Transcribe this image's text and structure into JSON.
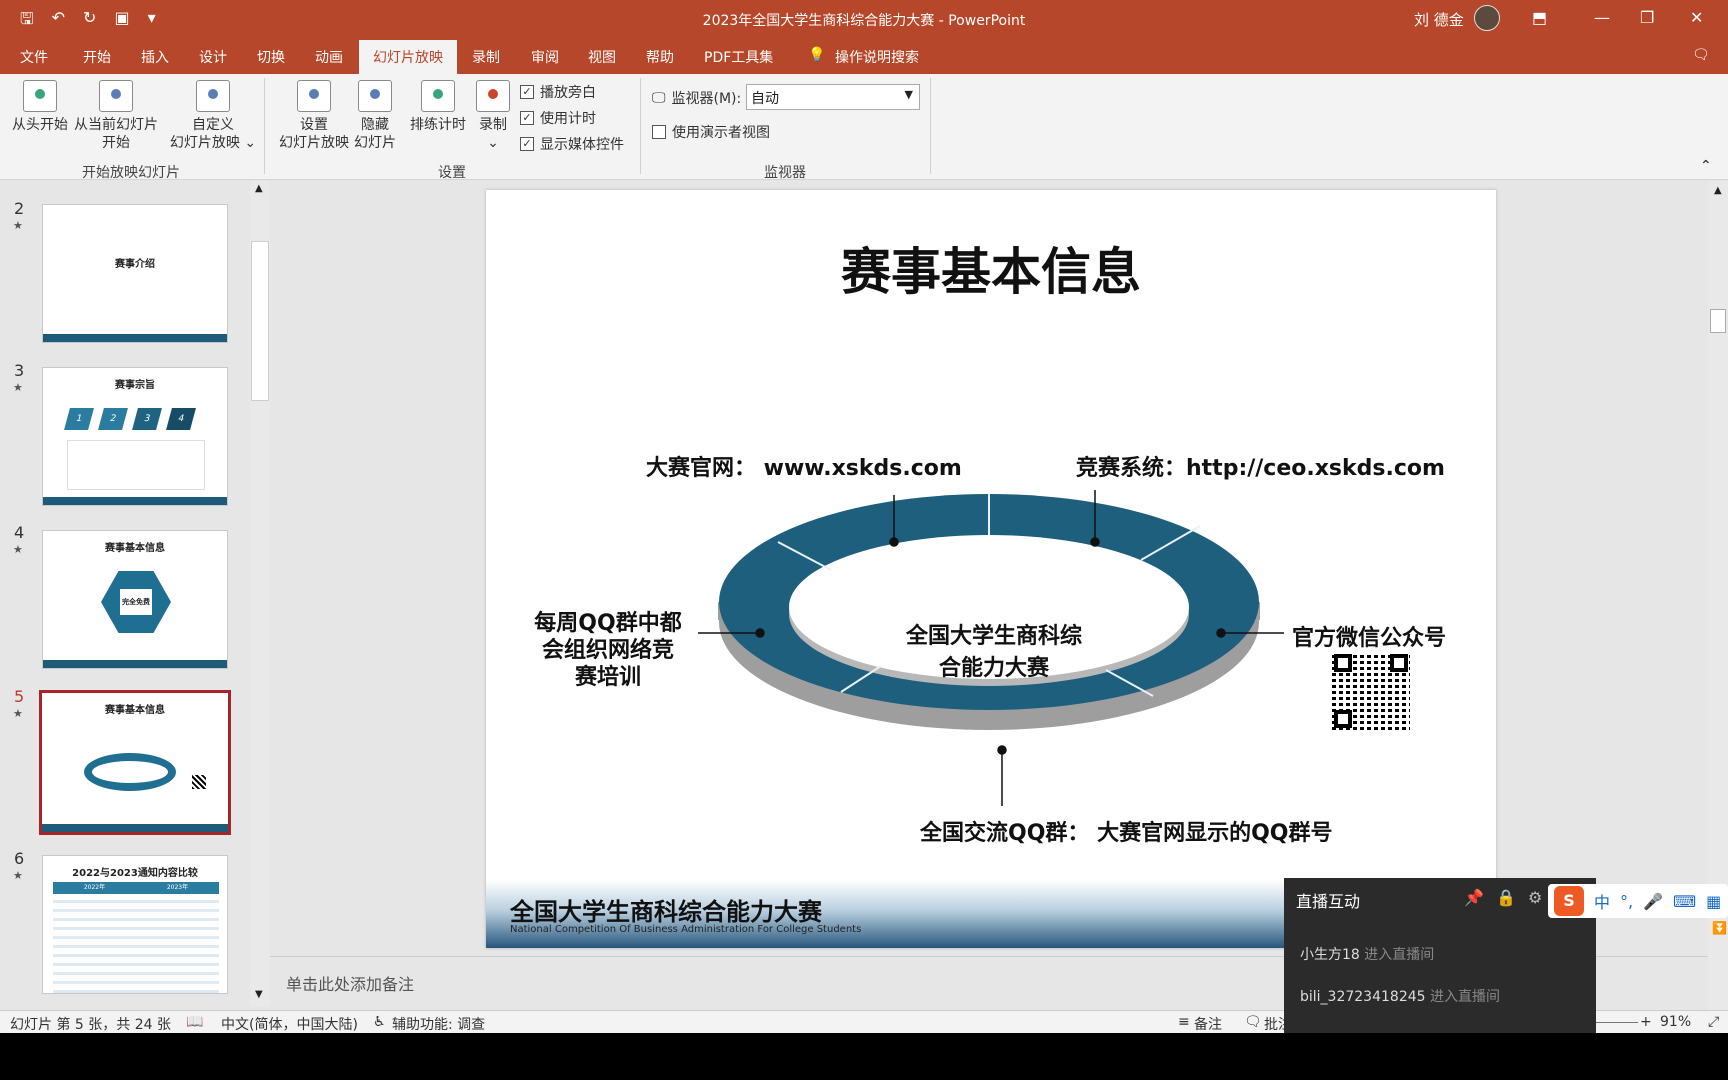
{
  "window": {
    "title": "2023年全国大学生商科综合能力大赛 - PowerPoint",
    "user": "刘 德金"
  },
  "qat": {
    "save_icon": "save-icon",
    "undo_icon": "undo-icon",
    "redo_icon": "redo-icon",
    "present_icon": "present-icon"
  },
  "tabs": [
    "文件",
    "开始",
    "插入",
    "设计",
    "切换",
    "动画",
    "幻灯片放映",
    "录制",
    "审阅",
    "视图",
    "帮助",
    "PDF工具集"
  ],
  "active_tab": "幻灯片放映",
  "tellme": "操作说明搜索",
  "ribbon": {
    "from_start": "从头开始",
    "from_current_1": "从当前幻灯片",
    "from_current_2": "开始",
    "custom_1": "自定义",
    "custom_2": "幻灯片放映 ⌄",
    "group_start": "开始放映幻灯片",
    "setup_1": "设置",
    "setup_2": "幻灯片放映",
    "hide_1": "隐藏",
    "hide_2": "幻灯片",
    "rehearse": "排练计时",
    "record": "录制",
    "record_arrow": "⌄",
    "play_narration": "播放旁白",
    "use_timings": "使用计时",
    "show_media": "显示媒体控件",
    "group_setup": "设置",
    "monitor_label": "监视器(M):",
    "monitor_value": "自动",
    "presenter_view": "使用演示者视图",
    "group_monitor": "监视器"
  },
  "thumbnails": [
    {
      "num": "2",
      "title": "赛事介绍",
      "footer": "全国大学生商科综合能力大赛"
    },
    {
      "num": "3",
      "title": "赛事宗旨",
      "steps": [
        "1",
        "2",
        "3",
        "4"
      ],
      "footer": "全国大学生商科综合能力大赛"
    },
    {
      "num": "4",
      "title": "赛事基本信息",
      "center": "完全免费",
      "footer": "全国大学生商科综合能力大赛"
    },
    {
      "num": "5",
      "title": "赛事基本信息",
      "footer": "全国大学生商科综合能力大赛"
    },
    {
      "num": "6",
      "title": "2022与2023通知内容比较",
      "cols": [
        "2022年",
        "2023年"
      ]
    }
  ],
  "slide": {
    "title": "赛事基本信息",
    "site": "大赛官网： www.xskds.com",
    "system": "竞赛系统：http://ceo.xskds.com",
    "center": "全国大学生商科综\n合能力大赛",
    "left": "每周QQ群中都\n会组织网络竞\n赛培训",
    "right": "官方微信公众号",
    "bottom": "全国交流QQ群： 大赛官网显示的QQ群号",
    "banner_cn": "全国大学生商科综合能力大赛",
    "banner_en": "National Competition Of Business Administration For College Students"
  },
  "notes_placeholder": "单击此处添加备注",
  "status": {
    "slide_info": "幻灯片 第 5 张，共 24 张",
    "language": "中文(简体，中国大陆)",
    "accessibility": "辅助功能: 调查",
    "notes": "备注",
    "comments": "批注",
    "zoom": "91%"
  },
  "live": {
    "title": "直播互动",
    "items": [
      {
        "user": "小生方18",
        "action": "进入直播间"
      },
      {
        "user": "bili_32723418245",
        "action": "进入直播间"
      }
    ]
  },
  "ime": {
    "labels": [
      "中",
      "°,"
    ]
  }
}
